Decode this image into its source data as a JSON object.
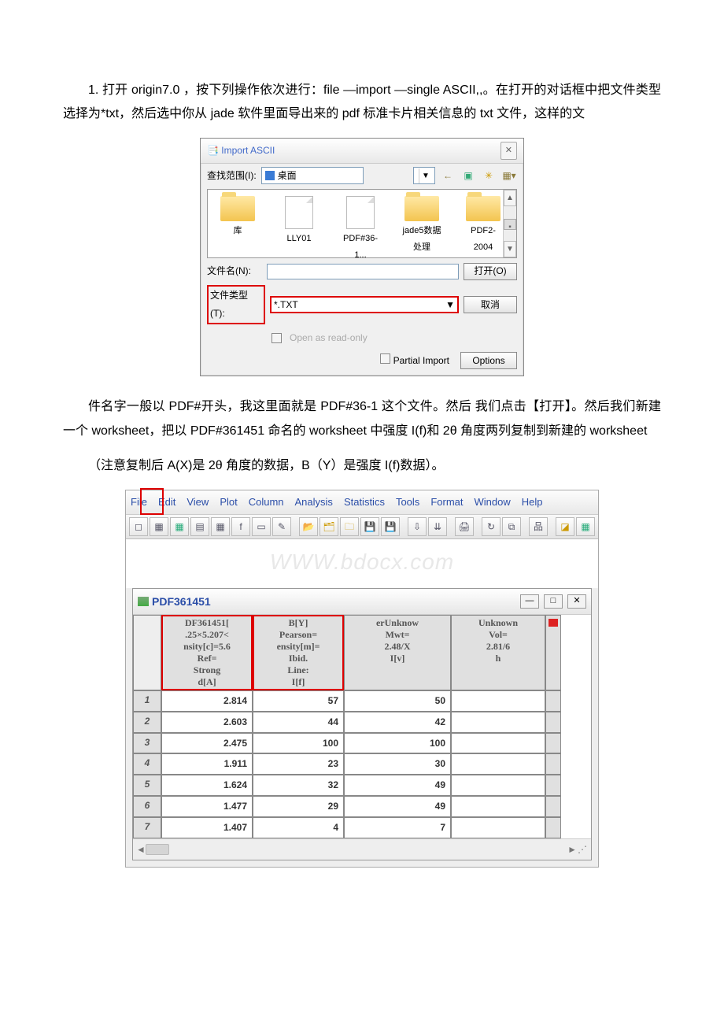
{
  "para1": "1. 打开 origin7.0 ，按下列操作依次进行：file —import —single ASCII,,。在打开的对话框中把文件类型选择为*txt，然后选中你从 jade 软件里面导出来的 pdf 标准卡片相关信息的 txt 文件，这样的文",
  "para2": "件名字一般以 PDF#开头，我这里面就是 PDF#36-1 这个文件。然后 我们点击【打开】。然后我们新建一个 worksheet，把以 PDF#361451 命名的 worksheet 中强度 I(f)和 2θ 角度两列复制到新建的 worksheet",
  "para3": "（注意复制后 A(X)是 2θ 角度的数据，B（Y）是强度 I(f)数据）。",
  "dlg": {
    "title": "Import ASCII",
    "close": "✕",
    "lookin_lbl": "查找范围(I):",
    "lookin_val": "桌面",
    "files": [
      "库",
      "LLY01",
      "PDF#36-1...",
      "jade5数据处理",
      "PDF2-2004"
    ],
    "fname_lbl": "文件名(N):",
    "fname_val": "",
    "ftype_lbl": "文件类型(T):",
    "ftype_val": "*.TXT",
    "open_btn": "打开(O)",
    "cancel_btn": "取消",
    "readonly": "Open as read-only",
    "partial": "Partial Import",
    "options": "Options"
  },
  "menu": [
    "File",
    "Edit",
    "View",
    "Plot",
    "Column",
    "Analysis",
    "Statistics",
    "Tools",
    "Format",
    "Window",
    "Help"
  ],
  "watermark": "WWW.bdocx.com",
  "ws": {
    "title": "PDF361451",
    "min": "—",
    "max": "□",
    "close": "✕",
    "hdr": {
      "c0": "",
      "c1": "DF361451[\n.25×5.207<\nnsity[c]=5.6\nRef=\nStrong\nd[A]",
      "c2": "B[Y]\nPearson=\nensity[m]=\nIbid.\nLine:\nI[f]",
      "c3": "erUnknow\nMwt=\n2.48/X\nI[v]",
      "c4": "Unknown\nVol=\n2.81/6\nh",
      "c5": ""
    },
    "rows": [
      {
        "n": "1",
        "a": "2.814",
        "b": "57",
        "c": "50",
        "d": ""
      },
      {
        "n": "2",
        "a": "2.603",
        "b": "44",
        "c": "42",
        "d": ""
      },
      {
        "n": "3",
        "a": "2.475",
        "b": "100",
        "c": "100",
        "d": ""
      },
      {
        "n": "4",
        "a": "1.911",
        "b": "23",
        "c": "30",
        "d": ""
      },
      {
        "n": "5",
        "a": "1.624",
        "b": "32",
        "c": "49",
        "d": ""
      },
      {
        "n": "6",
        "a": "1.477",
        "b": "29",
        "c": "49",
        "d": ""
      },
      {
        "n": "7",
        "a": "1.407",
        "b": "4",
        "c": "7",
        "d": ""
      }
    ],
    "scroll_up": "▲",
    "scroll_dn": "▼",
    "scroll_l": "◄",
    "scroll_r": "►"
  }
}
